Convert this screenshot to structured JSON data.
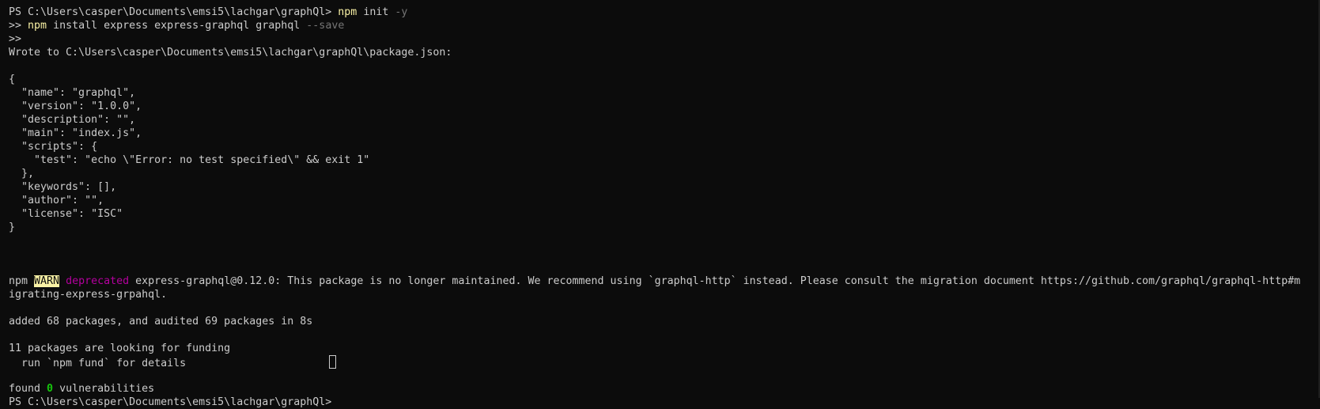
{
  "prompt": "PS C:\\Users\\casper\\Documents\\emsi5\\lachgar\\graphQl>",
  "line1": {
    "cmd": "npm",
    "args": " init ",
    "flag": "-y"
  },
  "line2": {
    "prefix": ">> ",
    "cmd": "npm",
    "args": " install express express-graphql graphql ",
    "flag": "--save"
  },
  "line3": ">>",
  "wrote": "Wrote to C:\\Users\\casper\\Documents\\emsi5\\lachgar\\graphQl\\package.json:",
  "json_lines": [
    "{",
    "  \"name\": \"graphql\",",
    "  \"version\": \"1.0.0\",",
    "  \"description\": \"\",",
    "  \"main\": \"index.js\",",
    "  \"scripts\": {",
    "    \"test\": \"echo \\\"Error: no test specified\\\" && exit 1\"",
    "  },",
    "  \"keywords\": [],",
    "  \"author\": \"\",",
    "  \"license\": \"ISC\"",
    "}"
  ],
  "warn": {
    "npm": "npm ",
    "badge": "WARN",
    "deprecated": "deprecated",
    "message": " express-graphql@0.12.0: This package is no longer maintained. We recommend using `graphql-http` instead. Please consult the migration document https://github.com/graphql/graphql-http#m",
    "message_cont": "igrating-express-grpahql."
  },
  "added": "added 68 packages, and audited 69 packages in 8s",
  "funding_1": "11 packages are looking for funding",
  "funding_2": "  run `npm fund` for details",
  "found": {
    "prefix": "found ",
    "count": "0",
    "suffix": " vulnerabilities"
  },
  "final_prompt": "PS C:\\Users\\casper\\Documents\\emsi5\\lachgar\\graphQl>",
  "colors": {
    "background": "#0c0c0c",
    "text": "#cccccc",
    "command": "#f9f1a5",
    "flag": "#767676",
    "deprecated": "#b4009e",
    "success": "#16c60c"
  }
}
